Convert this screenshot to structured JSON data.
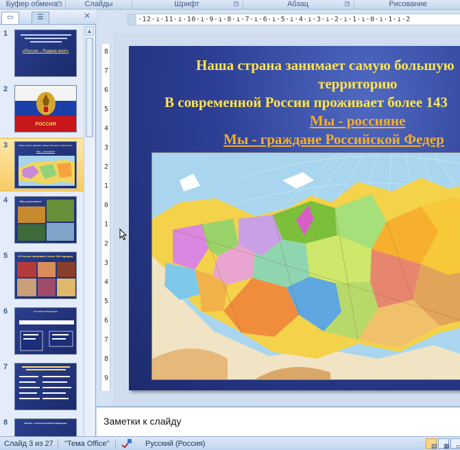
{
  "ribbon": {
    "groups": [
      "Буфер обмена",
      "Слайды",
      "Шрифт",
      "Абзац",
      "Рисование"
    ]
  },
  "slide_pane": {
    "tabs": [
      "slides-tab",
      "outline-tab"
    ],
    "thumbnails": [
      {
        "number": "1",
        "title": "",
        "subtitle": "«Россия – Родина моя!»"
      },
      {
        "number": "2",
        "title": "",
        "subtitle": "РОССИЯ"
      },
      {
        "number": "3",
        "title": "Наша страна занимает самую большую территорию",
        "subtitle": "Мы - россияне"
      },
      {
        "number": "4",
        "title": "«Мы, россияне!»",
        "subtitle": ""
      },
      {
        "number": "5",
        "title": "В России проживает более 180 народов",
        "subtitle": ""
      },
      {
        "number": "6",
        "title": "Российская Федерация",
        "subtitle": ""
      },
      {
        "number": "7",
        "title": "",
        "subtitle": ""
      },
      {
        "number": "8",
        "title": "Москва - столица Российской Федерации",
        "subtitle": ""
      }
    ]
  },
  "ruler": {
    "horizontal": "·12·ı·11·ı·10·ı·9·ı·8·ı·7·ı·6·ı·5·ı·4·ı·3·ı·2·ı·1·ı·0·ı·1·ı·2",
    "vertical": [
      "8",
      "7",
      "6",
      "5",
      "4",
      "3",
      "2",
      "1",
      "0",
      "1",
      "2",
      "3",
      "4",
      "5",
      "6",
      "7",
      "8",
      "9"
    ]
  },
  "slide": {
    "line1": "Наша страна занимает самую большую",
    "line2": "территорию",
    "line3": "В современной России проживает более 143",
    "link1": "Мы - россияне",
    "link2": "Мы - граждане Российской Федер",
    "colors": {
      "title": "#ffe44a",
      "link": "#f5b028",
      "background": "#2d3f95"
    }
  },
  "notes": {
    "placeholder": "Заметки к слайду"
  },
  "status": {
    "slide_counter": "Слайд 3 из 27",
    "theme": "\"Тема Office\"",
    "language": "Русский (Россия)"
  }
}
